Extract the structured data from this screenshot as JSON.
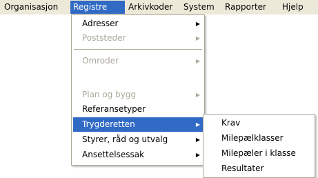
{
  "menubar": {
    "items": [
      {
        "label": "Organisasjon"
      },
      {
        "label": "Registre"
      },
      {
        "label": "Arkivkoder"
      },
      {
        "label": "System"
      },
      {
        "label": "Rapporter"
      },
      {
        "label": "Hjelp"
      }
    ]
  },
  "registre_menu": {
    "items": [
      {
        "label": "Adresser",
        "submenu_icon": "triangle-right"
      },
      {
        "label": "Poststeder",
        "submenu_icon": "triangle-right"
      },
      {
        "label": "Omroder",
        "submenu_icon": "triangle-right"
      },
      {
        "label": "Plan og bygg",
        "submenu_icon": "triangle-right"
      },
      {
        "label": "Referansetyper"
      },
      {
        "label": "Trygderetten",
        "submenu_icon": "triangle-right"
      },
      {
        "label": "Styrer, råd og utvalg",
        "submenu_icon": "triangle-right"
      },
      {
        "label": "Ansettelsessak",
        "submenu_icon": "triangle-right"
      }
    ]
  },
  "trygderetten_submenu": {
    "items": [
      {
        "label": "Krav"
      },
      {
        "label": "Milepælklasser"
      },
      {
        "label": "Milepæler i klasse"
      },
      {
        "label": "Resultater"
      }
    ]
  },
  "colors": {
    "menubar_bg": "#ece9d8",
    "highlight": "#316ac5",
    "disabled_text": "#aca899"
  }
}
